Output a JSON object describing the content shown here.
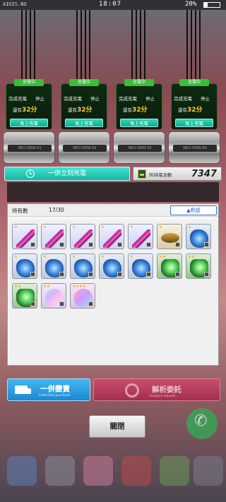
{
  "status_bar": {
    "carrier": "AIGIS.NG",
    "time": "18:07",
    "battery": "20%",
    "battery_level": 0.2
  },
  "chargers": [
    {
      "status": "充電中",
      "label_complete": "完成充電",
      "label_stop": "停止",
      "remaining_prefix": "還有",
      "remaining_value": "32分",
      "action": "馬上充電",
      "device_code": "NEO-VIEW-01"
    },
    {
      "status": "充電中",
      "label_complete": "完成充電",
      "label_stop": "停止",
      "remaining_prefix": "還有",
      "remaining_value": "32分",
      "action": "馬上充電",
      "device_code": "NEO-VIEW-02"
    },
    {
      "status": "充電中",
      "label_complete": "完成充電",
      "label_stop": "停止",
      "remaining_prefix": "還有",
      "remaining_value": "32分",
      "action": "馬上充電",
      "device_code": "NEO-VIEW-03"
    },
    {
      "status": "充電中",
      "label_complete": "完成充電",
      "label_stop": "停止",
      "remaining_prefix": "還有",
      "remaining_value": "32分",
      "action": "馬上充電",
      "device_code": "NEO-VIEW-04"
    }
  ],
  "charge_all": {
    "label": "一併立刻充電",
    "icon": "clock-icon"
  },
  "battery_stock": {
    "label": "所持電池數",
    "value": "7347",
    "icon": "battery-icon"
  },
  "inventory": {
    "count_label": "持有數",
    "count_value": "17/30",
    "sort_label": "▲默認",
    "items": [
      {
        "type": "crystal",
        "stars": "★"
      },
      {
        "type": "crystal",
        "stars": "★"
      },
      {
        "type": "crystal",
        "stars": "★"
      },
      {
        "type": "crystal",
        "stars": "★"
      },
      {
        "type": "crystal",
        "stars": "★"
      },
      {
        "type": "gold",
        "stars": "★"
      },
      {
        "type": "blue",
        "stars": "★"
      },
      {
        "type": "blue",
        "stars": "★"
      },
      {
        "type": "blue",
        "stars": "★"
      },
      {
        "type": "blue",
        "stars": "★"
      },
      {
        "type": "blue",
        "stars": "★"
      },
      {
        "type": "blue",
        "stars": "★"
      },
      {
        "type": "green",
        "stars": "★★"
      },
      {
        "type": "green",
        "stars": "★★"
      },
      {
        "type": "green",
        "stars": "★★"
      },
      {
        "type": "shell",
        "stars": "★★"
      },
      {
        "type": "pinkshell",
        "stars": "★★★★"
      }
    ]
  },
  "bulk_buy": {
    "label": "一併變賣",
    "sub": "Collective purchase",
    "icon": "truck-icon"
  },
  "analysis": {
    "label": "解析委託",
    "sub": "Analysis request",
    "icon": "ring-icon"
  },
  "close": {
    "label": "關閉"
  }
}
